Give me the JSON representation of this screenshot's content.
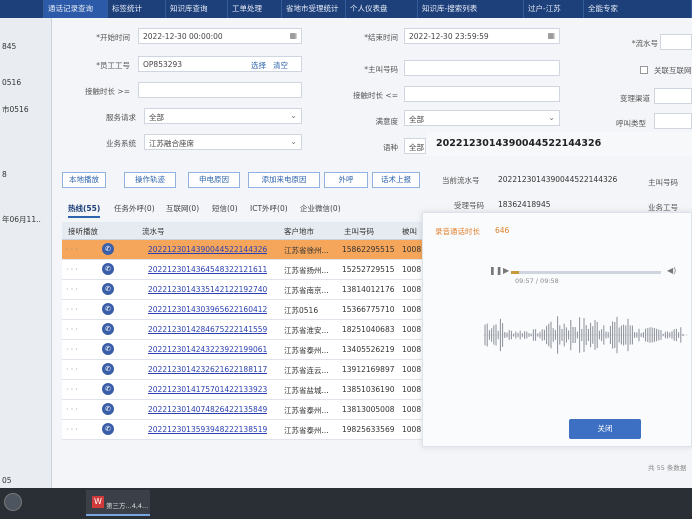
{
  "nav": {
    "tabs": [
      "",
      "通话记录查询",
      "标签统计",
      "知识库查询",
      "工单处理",
      "省地市受理统计",
      "个人仪表盘",
      "知识库-搜索列表",
      "过户-江苏",
      "全能专家"
    ]
  },
  "left": {
    "items": [
      "845",
      "0516",
      "市0516",
      "8",
      "年06月11..",
      "05"
    ]
  },
  "form": {
    "start_time_label": "*开始时间",
    "start_time_value": "2022-12-30 00:00:00",
    "end_time_label": "*结束时间",
    "end_time_value": "2022-12-30 23:59:59",
    "flow_label": "*流水号",
    "staff_label": "*员工工号",
    "staff_value": "OP853293",
    "select_link": "选择",
    "clear_link": "清空",
    "caller_label": "*主叫号码",
    "related_label": "关联互联网",
    "answer_len_label": "接触时长 >=",
    "answer_len2_label": "接触时长 <=",
    "change_channel_label": "变理渠道",
    "service_label": "服务请求",
    "service_value": "全部",
    "satisfaction_label": "满意度",
    "satisfaction_value": "全部",
    "call_type_label": "呼叫类型",
    "system_label": "业务系统",
    "system_value": "江苏融合座席",
    "lang_label": "语种",
    "lang_value": "全部"
  },
  "buttons": [
    "本地播放",
    "操作轨迹",
    "申电原因",
    "添加来电原因",
    "外呼",
    "话术上报"
  ],
  "subtabs": [
    "热线(55)",
    "任务外呼(0)",
    "互联网(0)",
    "短信(0)",
    "ICT外呼(0)",
    "企业微信(0)"
  ],
  "table": {
    "headers": [
      "接听播放",
      "流水号",
      "客户地市",
      "主叫号码",
      "被叫"
    ],
    "rows": [
      {
        "id": "20221230143900445221443​26",
        "city": "江苏省徐州...",
        "num": "15862295515",
        "cut": "1008"
      },
      {
        "id": "20221230143645483221216​11",
        "city": "江苏省扬州...",
        "num": "15252729515",
        "cut": "1008"
      },
      {
        "id": "20221230143351421221927​40",
        "city": "江苏省南京...",
        "num": "13814012176",
        "cut": "1008"
      },
      {
        "id": "20221230143039656221604​12",
        "city": "江苏0516",
        "num": "15366775710",
        "cut": "1008"
      },
      {
        "id": "20221230142846752221415​59",
        "city": "江苏省淮安...",
        "num": "18251040683",
        "cut": "1008"
      },
      {
        "id": "20221230142432239221990​61",
        "city": "江苏省泰州...",
        "num": "13405526219",
        "cut": "1008"
      },
      {
        "id": "20221230142326216221881​17",
        "city": "江苏省连云...",
        "num": "13912169897",
        "cut": "1008"
      },
      {
        "id": "20221230141757014221339​23",
        "city": "江苏省盐城...",
        "num": "13851036190",
        "cut": "1008"
      },
      {
        "id": "20221230140748264221358​49",
        "city": "江苏省泰州...",
        "num": "13813005008",
        "cut": "1008"
      },
      {
        "id": "20221230135939482221385​19",
        "city": "江苏省泰州...",
        "num": "19825633569",
        "cut": "1008"
      }
    ]
  },
  "detail": {
    "big_id": "20221230143900445221443​26",
    "current_flow_label": "当前流水号",
    "current_flow_value": "20221230143900445221443​26",
    "caller_label": "主叫号码",
    "accept_label": "受理号码",
    "accept_value": "18362418945",
    "biz_label": "业务工号"
  },
  "dialog": {
    "duration_label": "录音通话时长",
    "duration_value": "646",
    "time_text": "09:57 / 09:58",
    "progress": 0.05,
    "close_label": "关闭"
  },
  "footer": {
    "count": "共 55 条数据"
  },
  "taskbar": {
    "app_label": "第三方...4,4..."
  }
}
